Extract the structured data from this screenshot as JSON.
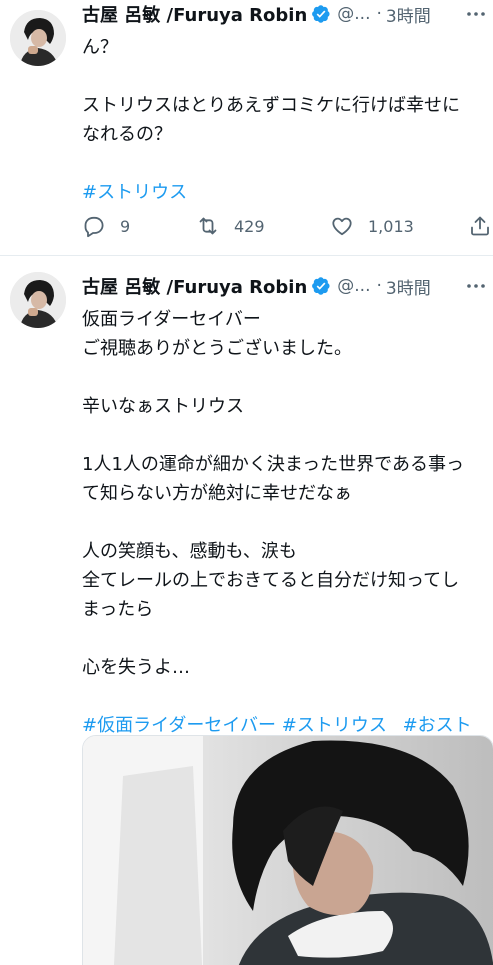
{
  "tweets": [
    {
      "author_name": "古屋 呂敏 /Furuya Robin",
      "handle": "@...",
      "separator": "·",
      "time": "3時間",
      "lines": [
        "ん？",
        "",
        "ストリウスはとりあえずコミケに行けば幸せに",
        "なれるの？",
        "",
        "#ストリウス"
      ],
      "replies": "9",
      "retweets": "429",
      "likes": "1,013"
    },
    {
      "author_name": "古屋 呂敏 /Furuya Robin",
      "handle": "@...",
      "separator": "·",
      "time": "3時間",
      "lines": [
        "仮面ライダーセイバー",
        "ご視聴ありがとうございました。",
        "",
        "辛いなぁストリウス",
        "",
        "1人1人の運命が細かく決まった世界である事っ",
        "て知らない方が絶対に幸せだなぁ",
        "",
        "人の笑顔も、感動も、涙も",
        "全てレールの上でおきてると自分だけ知ってし",
        "まったら",
        "",
        "心を失うよ…",
        ""
      ],
      "hashtags": [
        "#仮面ライダーセイバー",
        "#ストリウス",
        "#おスト"
      ]
    }
  ],
  "colors": {
    "accent": "#1d9bf0",
    "text": "#0f1419",
    "secondary": "#536471",
    "divider": "#e6ecf0"
  },
  "icons": [
    "verified-badge-icon",
    "more-options-icon",
    "reply-icon",
    "retweet-icon",
    "like-icon",
    "share-icon"
  ]
}
